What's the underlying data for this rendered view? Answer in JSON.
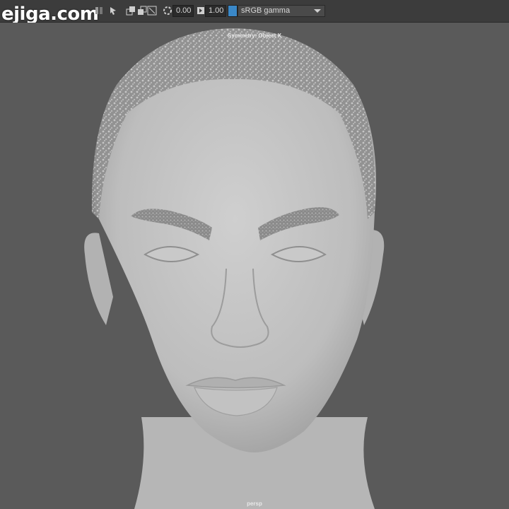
{
  "watermark": "ejiga.com",
  "toolbar": {
    "field1_value": "0.00",
    "field2_value": "1.00",
    "color_space": "sRGB gamma"
  },
  "viewport": {
    "symmetry_label": "Symmetry: Object X",
    "camera_label": "persp"
  },
  "colors": {
    "background": "#5a5a5a",
    "toolbar": "#3c3c3c",
    "skin": "#bdbdbd",
    "accent": "#3a88c8"
  },
  "icons": [
    "snap-icon",
    "select-icon",
    "camera-icon",
    "render-icon",
    "exposure-icon",
    "gamma-icon",
    "color-space-icon",
    "chevron-down-icon"
  ]
}
